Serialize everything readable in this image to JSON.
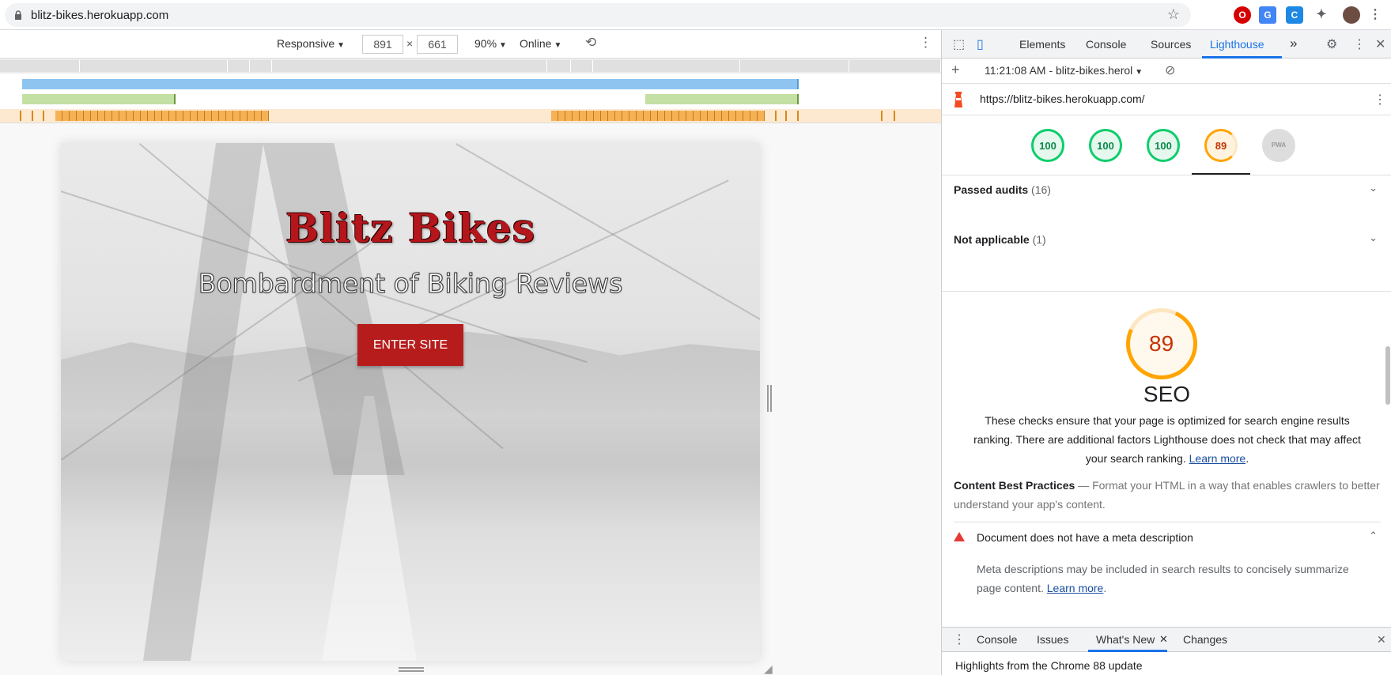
{
  "browser": {
    "url": "blitz-bikes.herokuapp.com"
  },
  "device_toolbar": {
    "device": "Responsive",
    "width": "891",
    "times": "×",
    "height": "661",
    "zoom": "90%",
    "throttle": "Online"
  },
  "site": {
    "title": "Blitz Bikes",
    "subtitle": "Bombardment of Biking Reviews",
    "button": "ENTER SITE"
  },
  "devtools": {
    "tabs": [
      "Elements",
      "Console",
      "Sources",
      "Lighthouse"
    ],
    "more": "»",
    "report_label": "11:21:08 AM - blitz-bikes.herol",
    "page_url": "https://blitz-bikes.herokuapp.com/",
    "scores": [
      "100",
      "100",
      "100",
      "89",
      "PWA"
    ],
    "passed_label": "Passed audits",
    "passed_count": "(16)",
    "na_label": "Not applicable",
    "na_count": "(1)",
    "seo_score": "89",
    "seo_title": "SEO",
    "seo_desc": "These checks ensure that your page is optimized for search engine results ranking. There are additional factors Lighthouse does not check that may affect your search ranking.",
    "learn_more": "Learn more",
    "cbp_title": "Content Best Practices",
    "cbp_dash": "—",
    "cbp_text": "Format your HTML in a way that enables crawlers to better understand your app's content.",
    "audit_title": "Document does not have a meta description",
    "audit_body": "Meta descriptions may be included in search results to concisely summarize page content.",
    "drawer_tabs": [
      "Console",
      "Issues",
      "What's New",
      "Changes"
    ],
    "drawer_msg": "Highlights from the Chrome 88 update"
  },
  "colors": {
    "accent": "#1a73e8",
    "brand_red": "#b71c1c",
    "score_green": "#0cce6b",
    "score_orange": "#ffa400"
  }
}
